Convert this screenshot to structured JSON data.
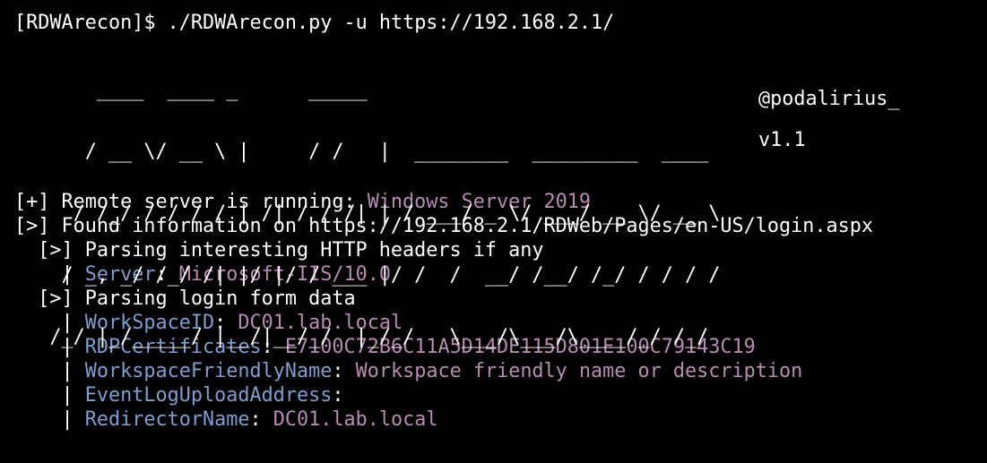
{
  "terminal": {
    "prompt": "[RDWArecon]$ ",
    "command": "./RDWArecon.py -u https://192.168.2.1/"
  },
  "banner": {
    "lines": [
      "       ____  ____ _      _____",
      "      / __ \\/ __ \\ |     / /   |  ________  _________  ____",
      "     / /_/ / / / / | /| / / /| | / ___/ _ \\/ ___/ __ \\/ __ \\",
      "    / _, _/ /_/ /| |/ |/ / ___ |/ /  /  __/ /__/ /_/ / / / /",
      "   /_/ |_/_____/ |__/|__/_/  |_/_/   \\___/\\___/\\____/_/ /_/"
    ],
    "author": "@podalirius_",
    "version": "v1.1"
  },
  "output": {
    "remote_prefix": "[+] Remote server is running: ",
    "remote_value": "Windows Server 2019",
    "found_line": "[>] Found information on https://192.168.2.1/RDWeb/Pages/en-US/login.aspx",
    "headers_line": "  [>] Parsing interesting HTTP headers if any",
    "headers": [
      {
        "key": "Server",
        "value": "Microsoft-IIS/10.0"
      }
    ],
    "form_line": "  [>] Parsing login form data",
    "form": [
      {
        "key": "WorkSpaceID",
        "value": "DC01.lab.local"
      },
      {
        "key": "RDPCertificates",
        "value": "E7100C72B6C11A5D14DE115D801E100C79143C19"
      },
      {
        "key": "WorkspaceFriendlyName",
        "value": "Workspace friendly name or description"
      },
      {
        "key": "EventLogUploadAddress",
        "value": ""
      },
      {
        "key": "RedirectorName",
        "value": "DC01.lab.local"
      }
    ],
    "pipe_prefix": "    | ",
    "separator": ": "
  },
  "colors": {
    "background": "#000000",
    "text": "#ffffff",
    "value": "#b88bb3",
    "key": "#7a9fd1"
  }
}
